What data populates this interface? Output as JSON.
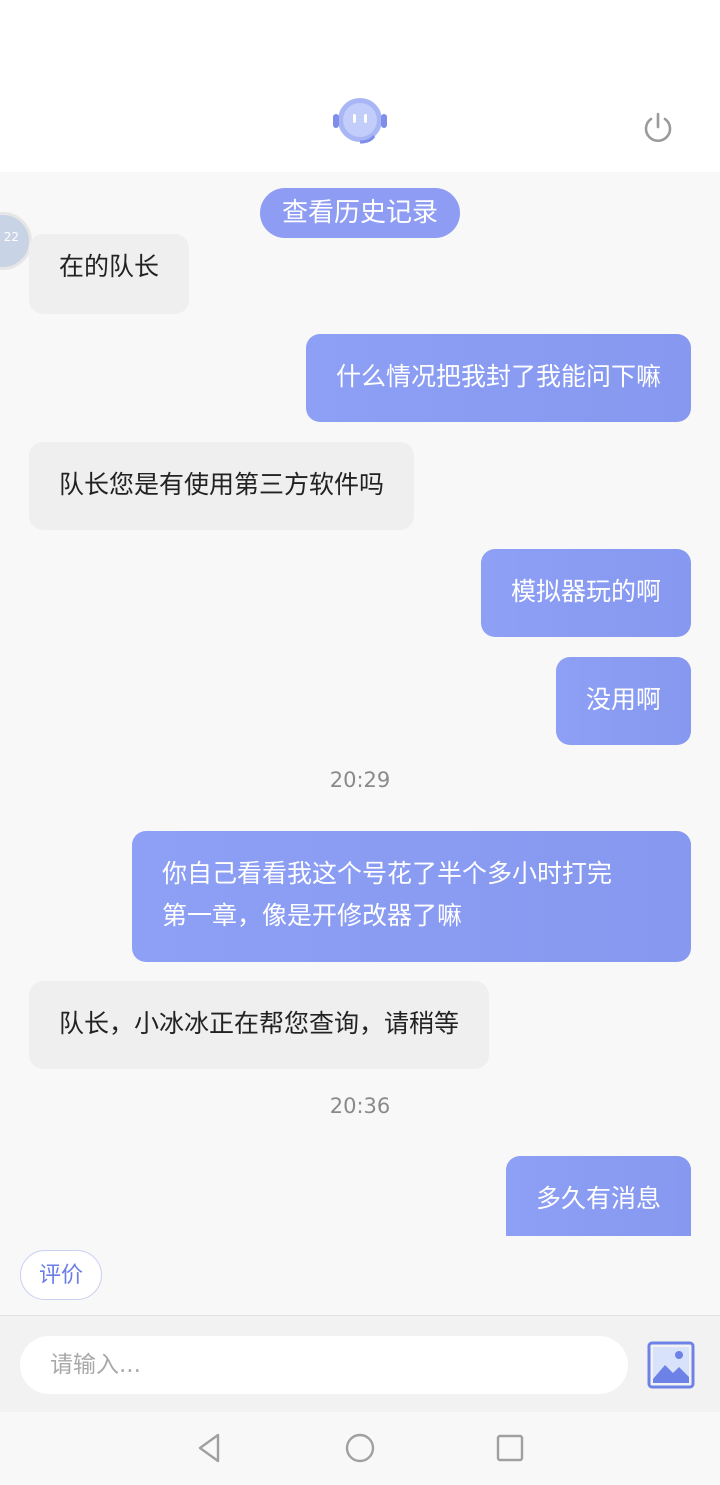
{
  "header": {
    "robot_icon": "robot-headset-icon",
    "power_icon": "power-icon"
  },
  "history": {
    "label": "查看历史记录"
  },
  "messages": [
    {
      "side": "left",
      "text": "在的队长"
    },
    {
      "side": "right",
      "text": "什么情况把我封了我能问下嘛"
    },
    {
      "side": "left",
      "text": "队长您是有使用第三方软件吗"
    },
    {
      "side": "right",
      "text": "模拟器玩的啊"
    },
    {
      "side": "right",
      "text": "没用啊"
    },
    {
      "side": "right",
      "text_line1": "你自己看看我这个号花了半个多小时打完",
      "text_line2": "第一章，像是开修改器了嘛"
    },
    {
      "side": "left",
      "text": "队长，小冰冰正在帮您查询，请稍等"
    },
    {
      "side": "right",
      "text": "多久有消息"
    }
  ],
  "timestamps": [
    "20:29",
    "20:36"
  ],
  "rate": {
    "label": "评价"
  },
  "composer": {
    "placeholder": "请输入...",
    "image_icon": "image-icon"
  },
  "navbar": {
    "back": "back-triangle-icon",
    "home": "home-circle-icon",
    "recents": "recents-square-icon"
  },
  "colors": {
    "accent": "#8e9cf4",
    "bubble_left": "#efefef",
    "bubble_right": "#8a9cf2"
  }
}
